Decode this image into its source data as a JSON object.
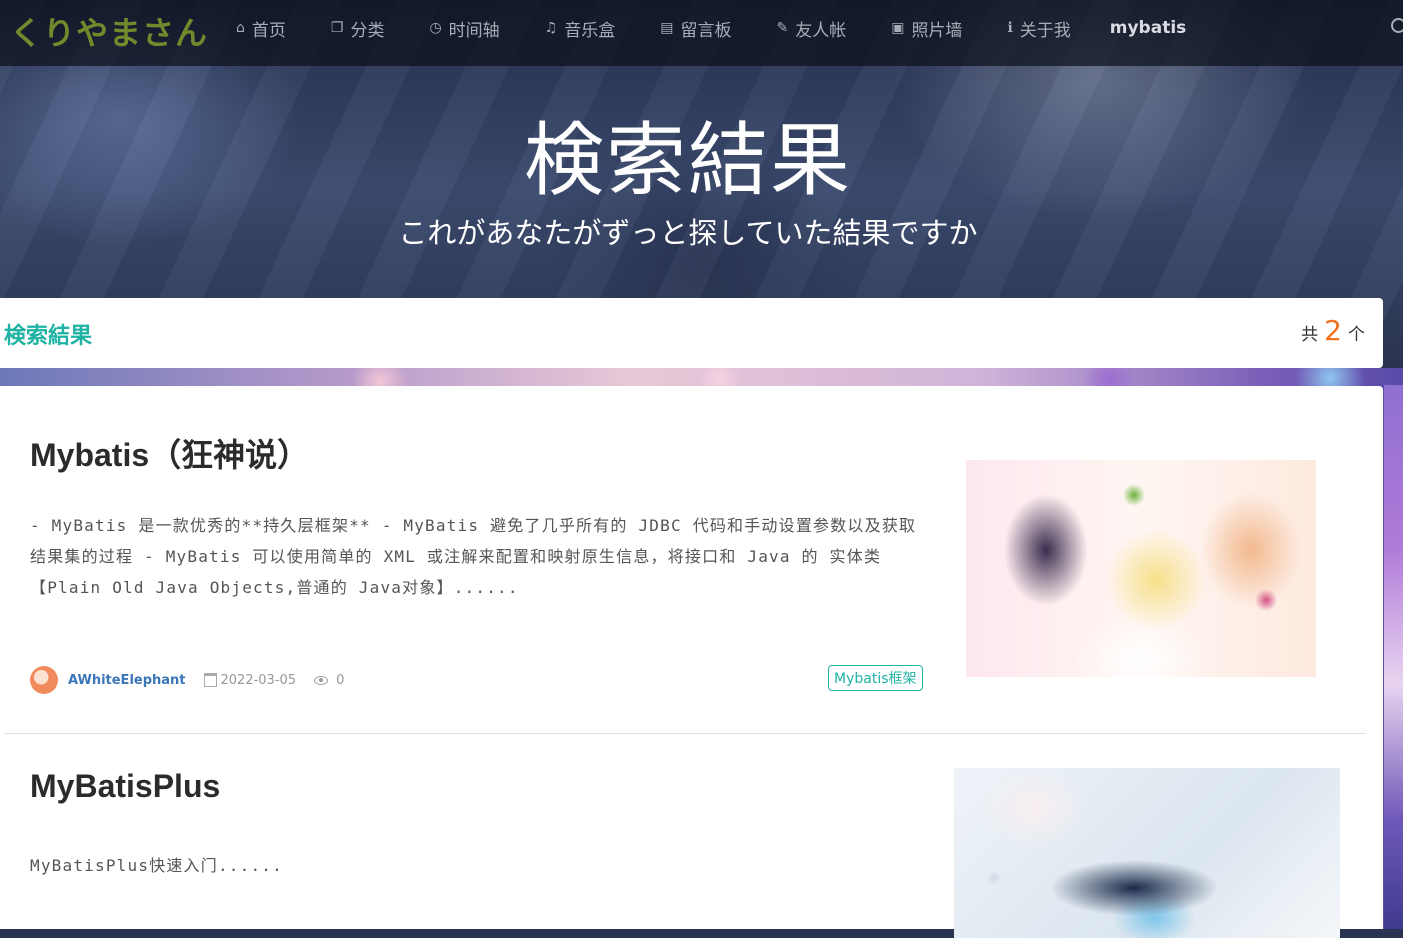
{
  "logo": "くりやまさん",
  "nav": {
    "items": [
      {
        "icon": "home-icon",
        "glyph": "⌂",
        "label": "首页"
      },
      {
        "icon": "copy-icon",
        "glyph": "❐",
        "label": "分类"
      },
      {
        "icon": "clock-icon",
        "glyph": "◷",
        "label": "时间轴"
      },
      {
        "icon": "music-icon",
        "glyph": "♫",
        "label": "音乐盒"
      },
      {
        "icon": "book-icon",
        "glyph": "▤",
        "label": "留言板"
      },
      {
        "icon": "pencil-icon",
        "glyph": "✎",
        "label": "友人帐"
      },
      {
        "icon": "picture-icon",
        "glyph": "▣",
        "label": "照片墙"
      },
      {
        "icon": "info-icon",
        "glyph": "ℹ",
        "label": "关于我"
      }
    ],
    "search_query": "mybatis"
  },
  "hero": {
    "title": "検索結果",
    "subtitle": "これがあなたがずっと探していた結果ですか"
  },
  "results_header": {
    "title": "検索結果",
    "count_prefix": "共",
    "count": "2",
    "count_suffix": "个"
  },
  "results": [
    {
      "title": "Mybatis（狂神说）",
      "description": "- MyBatis 是一款优秀的**持久层框架** - MyBatis 避免了几乎所有的 JDBC 代码和手动设置参数以及获取结果集的过程 - MyBatis 可以使用简单的 XML 或注解来配置和映射原生信息，将接口和 Java 的 实体类 【Plain Old Java Objects,普通的 Java对象】......",
      "author": "AWhiteElephant",
      "date": "2022-03-05",
      "views": "0",
      "tag": "Mybatis框架"
    },
    {
      "title": "MyBatisPlus",
      "description": "MyBatisPlus快速入门......"
    }
  ],
  "colors": {
    "accent": "#1fb3a5",
    "count": "#f2711c",
    "author": "#3a76b8",
    "logo": "#6f8b2b"
  }
}
